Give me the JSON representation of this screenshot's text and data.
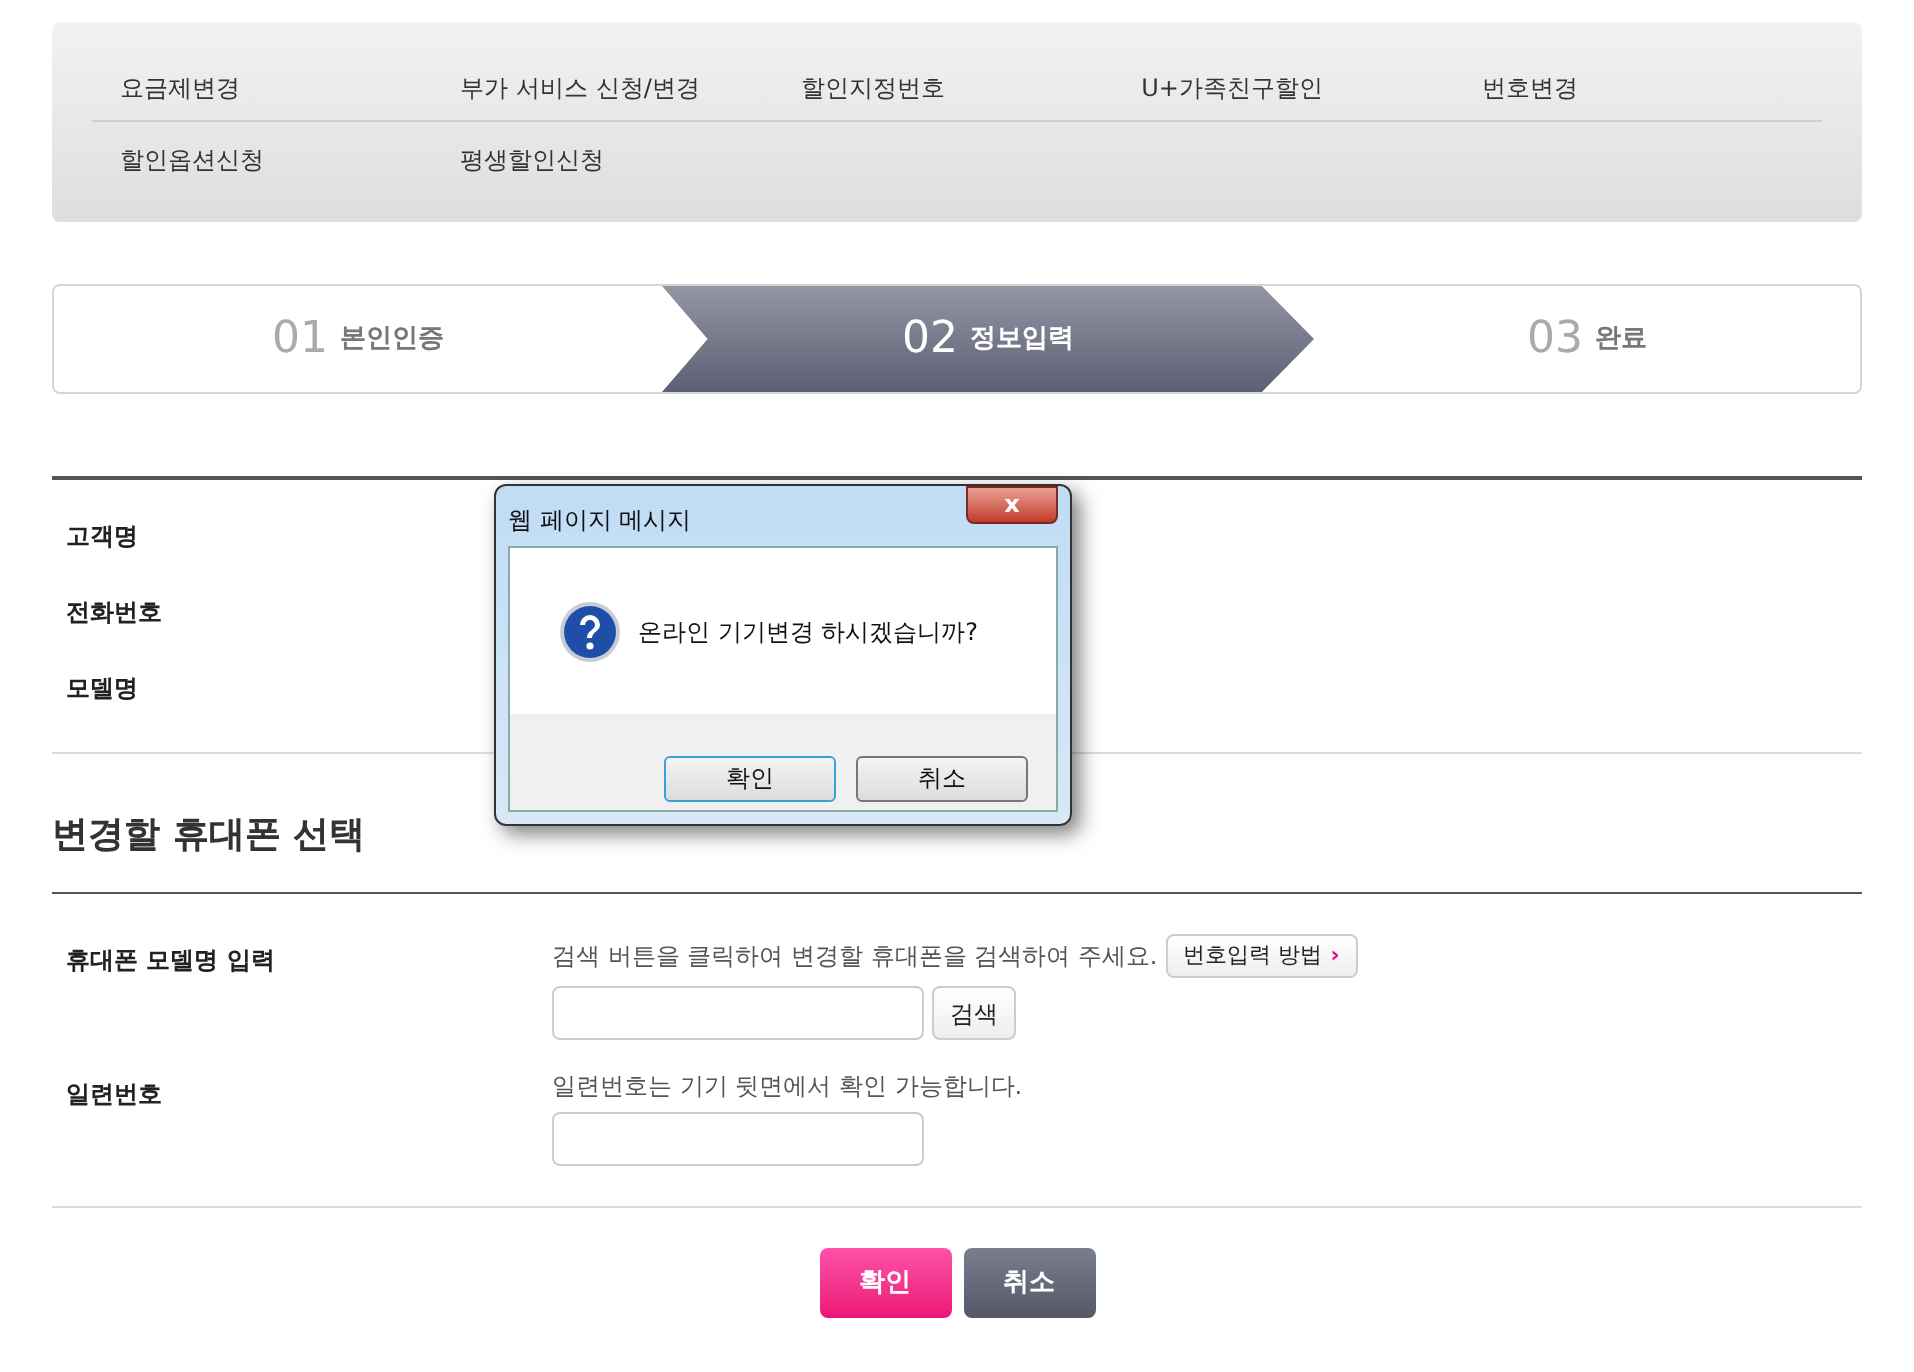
{
  "menu": {
    "items": [
      {
        "label": "요금제변경"
      },
      {
        "label": "부가 서비스 신청/변경"
      },
      {
        "label": "할인지정번호"
      },
      {
        "label": "U+가족친구할인"
      },
      {
        "label": "번호변경"
      },
      {
        "label": "할인옵션신청"
      },
      {
        "label": "평생할인신청"
      }
    ]
  },
  "steps": [
    {
      "number": "01",
      "label": "본인인증",
      "selected": false
    },
    {
      "number": "02",
      "label": "정보입력",
      "selected": true
    },
    {
      "number": "03",
      "label": "완료",
      "selected": false
    }
  ],
  "customer_info": [
    {
      "label": "고객명"
    },
    {
      "label": "전화번호"
    },
    {
      "label": "모델명"
    }
  ],
  "section_title": "변경할 휴대폰 선택",
  "form_rows": [
    {
      "kind": "search",
      "label": "휴대폰 모델명 입력",
      "help": "검색 버튼을 클릭하여 변경할 휴대폰을 검색하여 주세요.",
      "help_button": "번호입력 방법",
      "help_button_icon": "›",
      "search_button": "검색"
    },
    {
      "kind": "plain",
      "label": "일련번호",
      "help": "일련번호는 기기 뒷면에서 확인 가능합니다."
    }
  ],
  "buttons": [
    {
      "label": "확인",
      "kind": "primary"
    },
    {
      "label": "취소",
      "kind": "secondary"
    }
  ],
  "dialog": {
    "title": "웹 페이지 메시지",
    "close": "x",
    "message": "온라인 기기변경 하시겠습니까?",
    "buttons": [
      {
        "label": "확인",
        "selected": true
      },
      {
        "label": "취소",
        "selected": false
      }
    ]
  }
}
